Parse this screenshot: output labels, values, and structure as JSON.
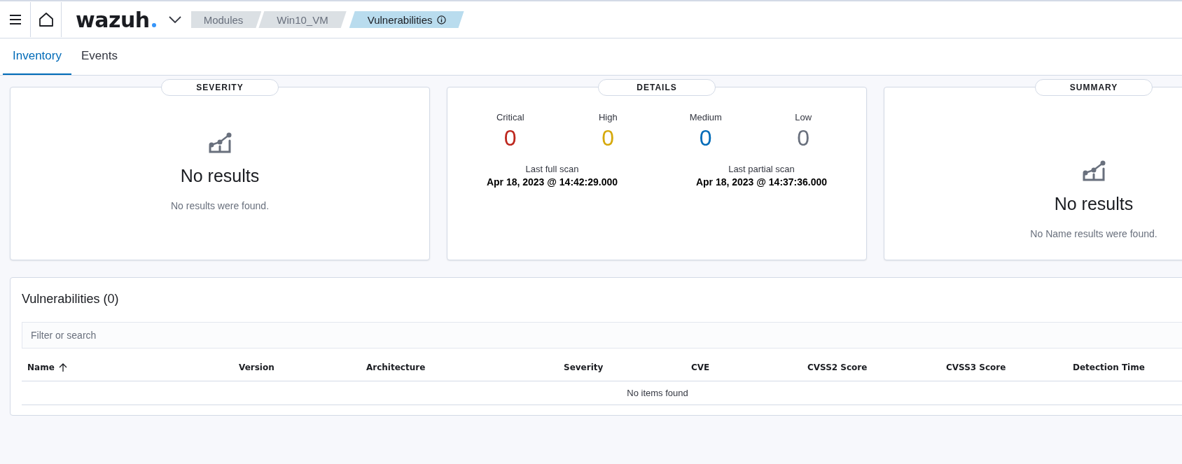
{
  "header": {
    "logo": "wazuh",
    "breadcrumbs": [
      {
        "label": "Modules",
        "selected": false,
        "info": false
      },
      {
        "label": "Win10_VM",
        "selected": false,
        "info": false
      },
      {
        "label": "Vulnerabilities",
        "selected": true,
        "info": true
      }
    ]
  },
  "tabs": [
    {
      "label": "Inventory",
      "selected": true
    },
    {
      "label": "Events",
      "selected": false
    }
  ],
  "cards": [
    {
      "kind": "empty",
      "title": "SEVERITY",
      "heading": "No results",
      "message": "No results were found."
    },
    {
      "kind": "details",
      "title": "DETAILS",
      "counts": [
        {
          "label": "Critical",
          "value": "0",
          "color": "#bd271e"
        },
        {
          "label": "High",
          "value": "0",
          "color": "#d6a90c"
        },
        {
          "label": "Medium",
          "value": "0",
          "color": "#006bb8"
        },
        {
          "label": "Low",
          "value": "0",
          "color": "#69707d"
        }
      ],
      "scans": [
        {
          "label": "Last full scan",
          "value": "Apr 18, 2023 @ 14:42:29.000"
        },
        {
          "label": "Last partial scan",
          "value": "Apr 18, 2023 @ 14:37:36.000"
        }
      ]
    },
    {
      "kind": "empty",
      "title": "SUMMARY",
      "heading": "No results",
      "message": "No Name results were found."
    }
  ],
  "table": {
    "title": "Vulnerabilities (0)",
    "search": {
      "placeholder": "Filter or search"
    },
    "columns": [
      {
        "label": "Name",
        "sorted": true
      },
      {
        "label": "Version",
        "sorted": false
      },
      {
        "label": "Architecture",
        "sorted": false
      },
      {
        "label": "Severity",
        "sorted": false
      },
      {
        "label": "CVE",
        "sorted": false
      },
      {
        "label": "CVSS2 Score",
        "sorted": false
      },
      {
        "label": "CVSS3 Score",
        "sorted": false
      },
      {
        "label": "Detection Time",
        "sorted": false
      }
    ],
    "empty_message": "No items found"
  }
}
